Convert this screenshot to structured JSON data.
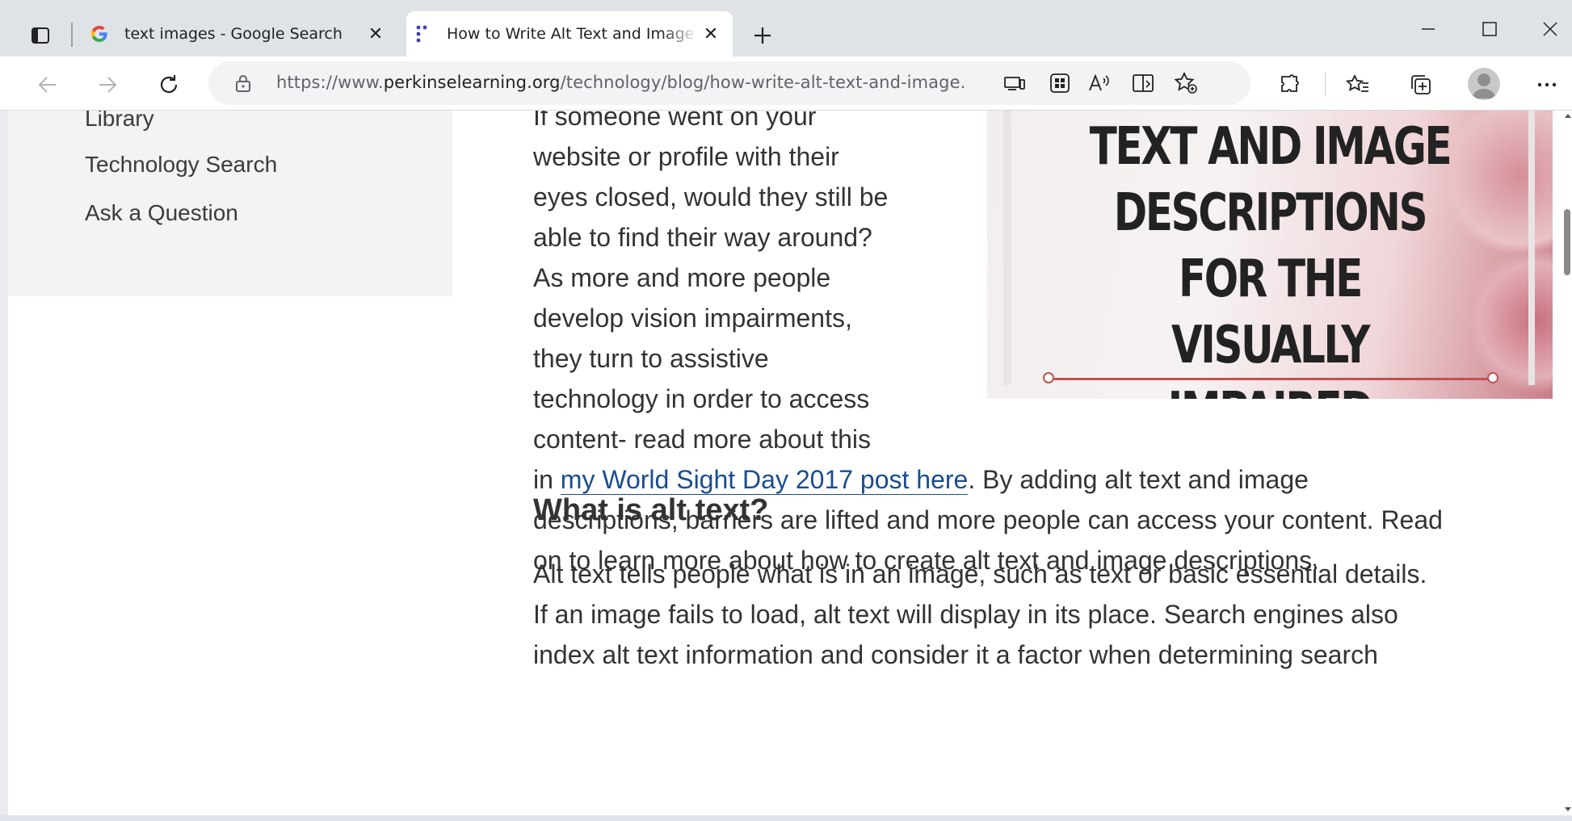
{
  "browser": {
    "tabs": [
      {
        "title": "text images - Google Search",
        "favicon": "google-g-icon",
        "active": false
      },
      {
        "title": "How to Write Alt Text and Image Descriptions for the Visually Impaired",
        "favicon": "perkins-dots-icon",
        "active": true
      }
    ],
    "address": {
      "url_prefix": "https://www.",
      "url_domain": "perkinselearning.org",
      "url_path": "/technology/blog/how-write-alt-text-and-image..."
    },
    "toolbar_icons": [
      "back-icon",
      "forward-icon",
      "refresh-icon",
      "lock-icon",
      "app-available-icon",
      "apps-icon",
      "read-aloud-icon",
      "immersive-reader-icon",
      "add-favorite-icon",
      "extensions-icon",
      "favorites-icon",
      "collections-icon",
      "profile-avatar",
      "more-icon"
    ],
    "accent": "#1a4d8f"
  },
  "sidebar": {
    "items": [
      {
        "label": "Library"
      },
      {
        "label": "Technology Search"
      },
      {
        "label": "Ask a Question"
      }
    ]
  },
  "article": {
    "hero_image_text": "TEXT AND IMAGE DESCRIPTIONS FOR THE VISUALLY IMPAIRED",
    "narrow_lines": [
      "If someone went on your",
      "website or profile with their",
      "eyes closed, would they still be",
      "able to find their way around?",
      "As more and more people",
      "develop vision impairments,",
      "they turn to assistive",
      "technology in order to access",
      "content- read more about this"
    ],
    "in_word": "in ",
    "link_text": "my World Sight Day 2017 post here",
    "after_link": ". By adding alt text and image",
    "wide_lines": [
      "descriptions, barriers are lifted and more people can access your content. Read",
      "on to learn more about how to create alt text and image descriptions."
    ],
    "heading": "What is alt text?",
    "para2_lines": [
      "Alt text tells people what is in an image, such as text or basic essential details.",
      "If an image fails to load, alt text will display in its place. Search engines also",
      "index alt text information and consider it a factor when determining search"
    ]
  }
}
